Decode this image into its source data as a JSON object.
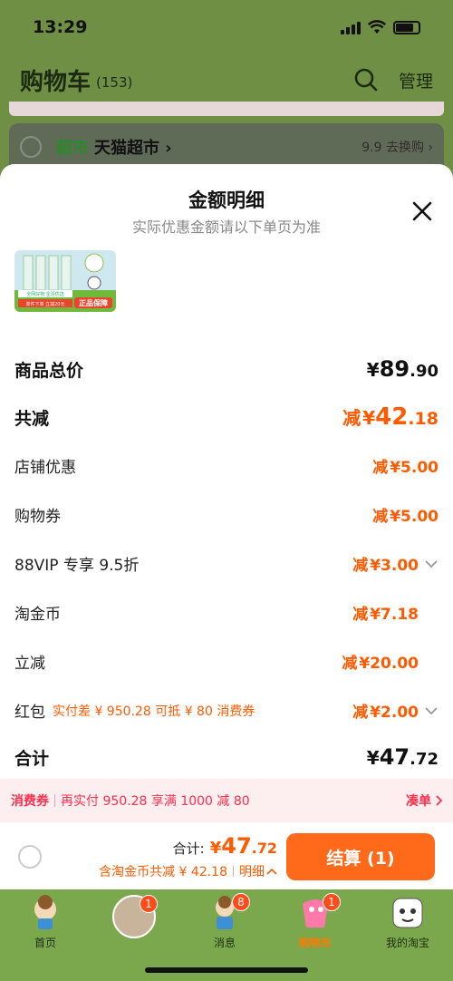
{
  "status_bar": {
    "time": "13:29"
  },
  "cart_header": {
    "title": "购物车",
    "count": "(153)",
    "manage": "管理"
  },
  "store": {
    "tag": "超市",
    "name": "天猫超市 ›",
    "right_text": "9.9 去换购 ›"
  },
  "sheet": {
    "title": "金额明细",
    "subtitle": "实际优惠金额请以下单页为准",
    "product_image_texts": [
      "全网好物 生活优选",
      "正品保障",
      "单件下单 立减20元"
    ],
    "rows": [
      {
        "label": "商品总价",
        "prefix": "",
        "currency": "¥",
        "int": "89",
        "dec": ".90",
        "note": ""
      },
      {
        "label": "共减",
        "prefix": "减",
        "currency": "¥",
        "int": "42",
        "dec": ".18",
        "note": ""
      },
      {
        "label": "店铺优惠",
        "prefix": "减",
        "currency": "¥",
        "int": "5",
        "dec": ".00",
        "note": ""
      },
      {
        "label": "购物券",
        "prefix": "减",
        "currency": "¥",
        "int": "5",
        "dec": ".00",
        "note": ""
      },
      {
        "label": "88VIP 专享 9.5折",
        "prefix": "减",
        "currency": "¥",
        "int": "3",
        "dec": ".00",
        "note": ""
      },
      {
        "label": "淘金币",
        "prefix": "减",
        "currency": "¥",
        "int": "7",
        "dec": ".18",
        "note": ""
      },
      {
        "label": "立减",
        "prefix": "减",
        "currency": "¥",
        "int": "20",
        "dec": ".00",
        "note": ""
      },
      {
        "label": "红包",
        "prefix": "减",
        "currency": "¥",
        "int": "2",
        "dec": ".00",
        "note": "实付差 ¥ 950.28 可抵 ¥ 80 消费券"
      },
      {
        "label": "合计",
        "prefix": "",
        "currency": "¥",
        "int": "47",
        "dec": ".72",
        "note": ""
      }
    ]
  },
  "coupon_bar": {
    "tag": "消费券",
    "message": "再实付 950.28 享满 1000 减 80",
    "action": "凑单"
  },
  "checkout": {
    "total_label": "合计:",
    "currency": "¥",
    "total_int": "47",
    "total_dec": ".72",
    "sub_text": "含淘金币共减 ¥ 42.18",
    "detail_link": "明细",
    "button": "结算 (1)"
  },
  "tabbar": {
    "items": [
      {
        "label": "首页",
        "badge": ""
      },
      {
        "label": "",
        "badge": "1"
      },
      {
        "label": "消息",
        "badge": "8"
      },
      {
        "label": "购物车",
        "badge": "1"
      },
      {
        "label": "我的淘宝",
        "badge": ""
      }
    ]
  },
  "colors": {
    "accent": "#ff5a00",
    "coupon_red": "#ff2e4c",
    "overlay_green": "#6e8f44",
    "checkout_button": "#ff6a1a"
  }
}
